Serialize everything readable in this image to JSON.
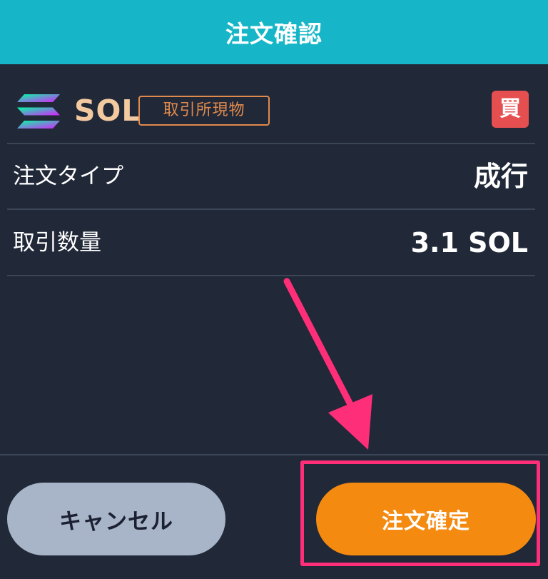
{
  "header": {
    "title": "注文確認"
  },
  "asset": {
    "symbol": "SOL",
    "market": "取引所現物",
    "side": "買",
    "logo_icon": "solana-logo-icon"
  },
  "rows": [
    {
      "label": "注文タイプ",
      "value": "成行"
    },
    {
      "label": "取引数量",
      "value": "3.1 SOL"
    }
  ],
  "buttons": {
    "cancel": "キャンセル",
    "confirm": "注文確定"
  },
  "annotation": {
    "arrow_icon": "pointer-arrow-icon",
    "color": "#ff2e78"
  },
  "colors": {
    "header_bg": "#16b6c8",
    "background": "#212838",
    "confirm_bg": "#f58a10",
    "cancel_bg": "#a8b4c8",
    "buy_badge": "#e54f4f",
    "market_badge": "#e08a4e"
  }
}
